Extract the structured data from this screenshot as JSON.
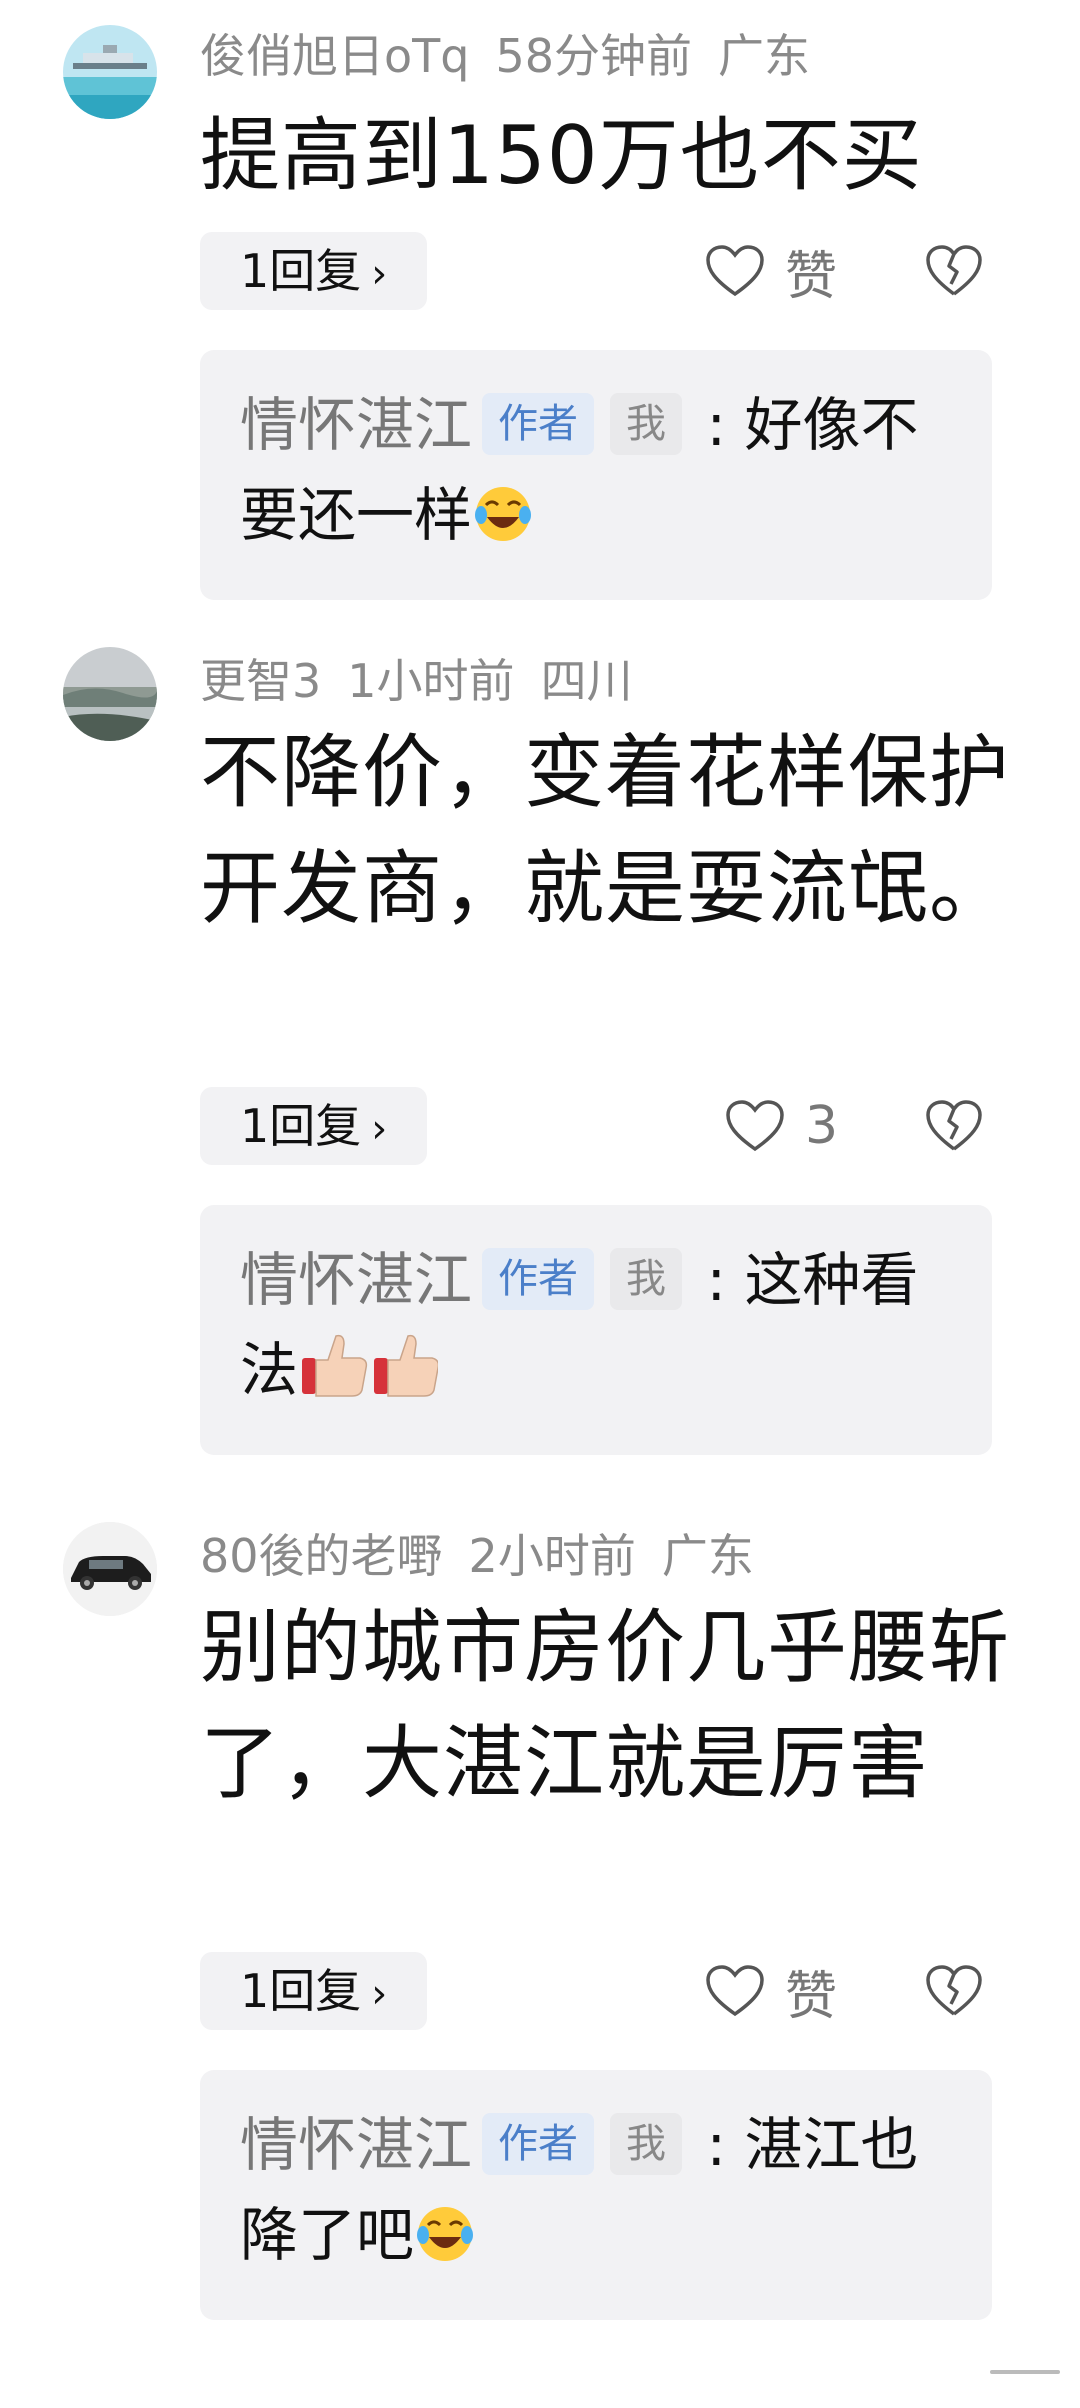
{
  "comments": [
    {
      "user": "俊俏旭日oTq",
      "time": "58分钟前",
      "location": "广东",
      "text": "提高到150万也不买",
      "reply_button": "1回复",
      "like_label": "赞",
      "reply": {
        "author": "情怀湛江",
        "tag_author": "作者",
        "tag_me": "我",
        "separator": ":",
        "text": "好像不要还一样",
        "emoji": "tears-of-joy"
      }
    },
    {
      "user": "更智3",
      "time": "1小时前",
      "location": "四川",
      "text": "不降价，变着花样保护开发商，就是耍流氓。",
      "reply_button": "1回复",
      "like_label": "3",
      "reply": {
        "author": "情怀湛江",
        "tag_author": "作者",
        "tag_me": "我",
        "separator": ":",
        "text": "这种看法",
        "emoji": "thumbs-up x2"
      }
    },
    {
      "user": "80後的老嘢",
      "time": "2小时前",
      "location": "广东",
      "text": "别的城市房价几乎腰斩了，大湛江就是厉害",
      "reply_button": "1回复",
      "like_label": "赞",
      "reply": {
        "author": "情怀湛江",
        "tag_author": "作者",
        "tag_me": "我",
        "separator": ":",
        "text": "湛江也降了吧",
        "emoji": "tears-of-joy"
      }
    }
  ],
  "colors": {
    "meta": "#8a8a8a",
    "tag_author_bg": "#e3ebf7",
    "tag_author_fg": "#4b7fc9",
    "panel_bg": "#f2f2f4"
  }
}
